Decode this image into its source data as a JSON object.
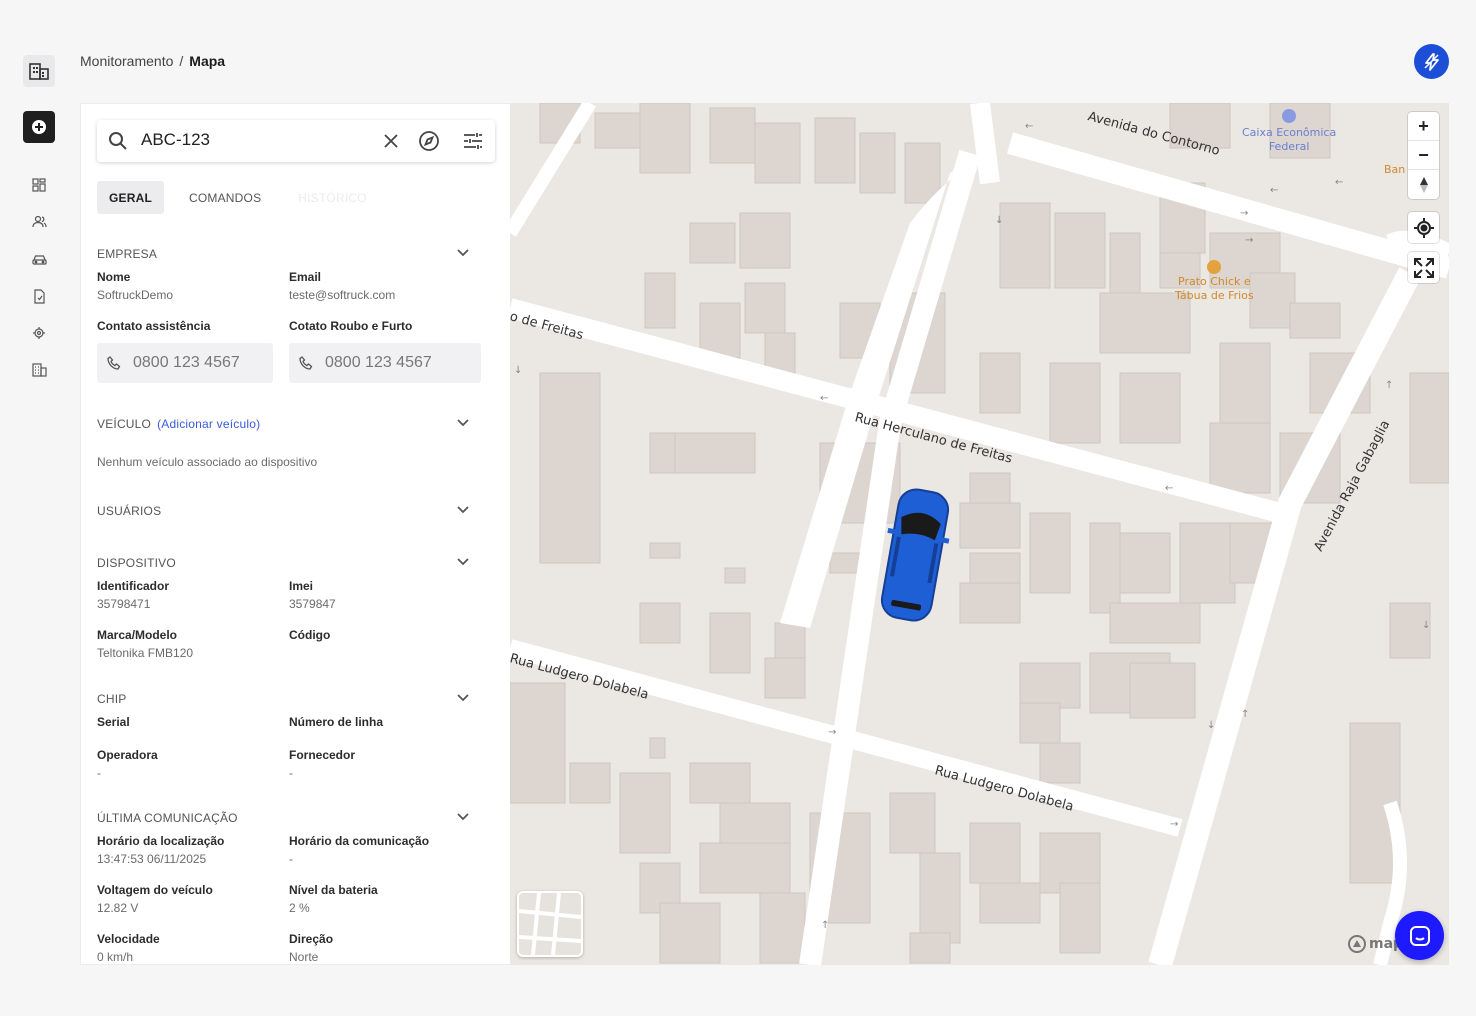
{
  "breadcrumb": {
    "parent": "Monitoramento",
    "separator": "/",
    "current": "Mapa"
  },
  "search": {
    "value": "ABC-123"
  },
  "tabs": [
    {
      "label": "GERAL"
    },
    {
      "label": "COMANDOS"
    },
    {
      "label": "HISTÓRICO"
    }
  ],
  "empresa": {
    "title": "EMPRESA",
    "nome_label": "Nome",
    "nome": "SoftruckDemo",
    "email_label": "Email",
    "email": "teste@softruck.com",
    "contato_label": "Contato assistência",
    "contato": "0800 123 4567",
    "roubo_label": "Cotato Roubo e Furto",
    "roubo": "0800 123 4567"
  },
  "veiculo": {
    "title": "VEÍCULO",
    "add_link": "(Adicionar veículo)",
    "empty": "Nenhum veículo associado ao dispositivo"
  },
  "usuarios": {
    "title": "USUÁRIOS"
  },
  "dispositivo": {
    "title": "DISPOSITIVO",
    "identificador_label": "Identificador",
    "identificador": "35798471",
    "imei_label": "Imei",
    "imei": "3579847",
    "marca_label": "Marca/Modelo",
    "marca": "Teltonika FMB120",
    "codigo_label": "Código"
  },
  "chip": {
    "title": "CHIP",
    "serial_label": "Serial",
    "linha_label": "Número de linha",
    "operadora_label": "Operadora",
    "operadora": "-",
    "fornecedor_label": "Fornecedor",
    "fornecedor": "-"
  },
  "comunicacao": {
    "title": "ÚLTIMA COMUNICAÇÃO",
    "hora_loc_label": "Horário da localização",
    "hora_loc": "13:47:53 06/11/2025",
    "hora_com_label": "Horário da comunicação",
    "hora_com": "-",
    "voltagem_label": "Voltagem do veículo",
    "voltagem": "12.82 V",
    "bateria_label": "Nível da bateria",
    "bateria": "2 %",
    "velocidade_label": "Velocidade",
    "velocidade": "0 km/h",
    "direcao_label": "Direção",
    "direcao": "Norte"
  },
  "map": {
    "streets": {
      "contorno": "Avenida do Contorno",
      "herculano": "Rua Herculano de Freitas",
      "herculano_partial": "o de Freitas",
      "ludgero_1": "Rua Ludgero Dolabela",
      "ludgero_2": "Rua Ludgero Dolabela",
      "raja": "Avenida Raja Gabaglia"
    },
    "pois": {
      "caixa_1": "Caixa Econômica",
      "caixa_2": "Federal",
      "prato_1": "Prato Chick e",
      "prato_2": "Tábua de Frios",
      "banco_partial": "Ban"
    },
    "attribution": "map",
    "controls": {
      "zoom_in": "+",
      "zoom_out": "−"
    }
  },
  "colors": {
    "brand": "#1d4ed8",
    "chat": "#1d1aff",
    "car": "#1f5fd6",
    "poi_orange": "#d08a2c",
    "poi_blue": "#6b7fd1"
  },
  "icons": [
    "building-icon",
    "plus-circle-icon",
    "dashboard-icon",
    "users-icon",
    "car-icon",
    "device-icon",
    "chip-icon",
    "company-icon",
    "search-icon",
    "close-icon",
    "compass-icon",
    "filter-icon",
    "chevron-down-icon",
    "phone-icon",
    "locate-icon",
    "fullscreen-icon",
    "chat-icon",
    "lightning-icon"
  ]
}
